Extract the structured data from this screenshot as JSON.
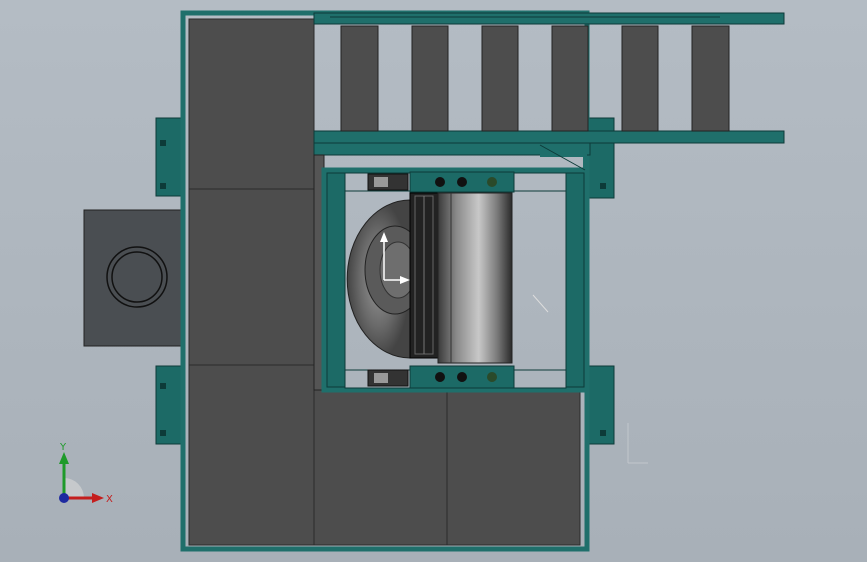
{
  "viewport": {
    "background": "#aeb6be",
    "frame_color": "#1f6f6b",
    "panel_color": "#4d4d4d",
    "roller_label": "roller-assembly"
  },
  "triad": {
    "x_label": "X",
    "y_label": "Y",
    "x_color": "#c41e1e",
    "y_color": "#1e9a2a",
    "z_color": "#1e2aa0"
  }
}
